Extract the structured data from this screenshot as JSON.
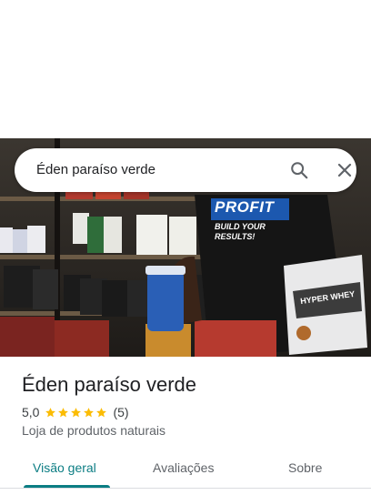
{
  "search": {
    "query": "Éden paraíso verde"
  },
  "icons": {
    "search": "search-icon",
    "close": "close-icon",
    "star": "star-icon"
  },
  "place": {
    "name": "Éden paraíso verde",
    "rating": "5,0",
    "stars_filled": 5,
    "reviews_count": "(5)",
    "category": "Loja de produtos naturais"
  },
  "photo": {
    "shirt_brand": "PROFIT",
    "shirt_slogan": "BUILD YOUR RESULTS!",
    "product_label": "HYPER WHEY"
  },
  "tabs": [
    {
      "label": "Visão geral",
      "active": true
    },
    {
      "label": "Avaliações",
      "active": false
    },
    {
      "label": "Sobre",
      "active": false
    }
  ],
  "colors": {
    "accent": "#0b7d83",
    "star": "#fbbc04",
    "text_primary": "#202124",
    "text_secondary": "#5f6368"
  }
}
